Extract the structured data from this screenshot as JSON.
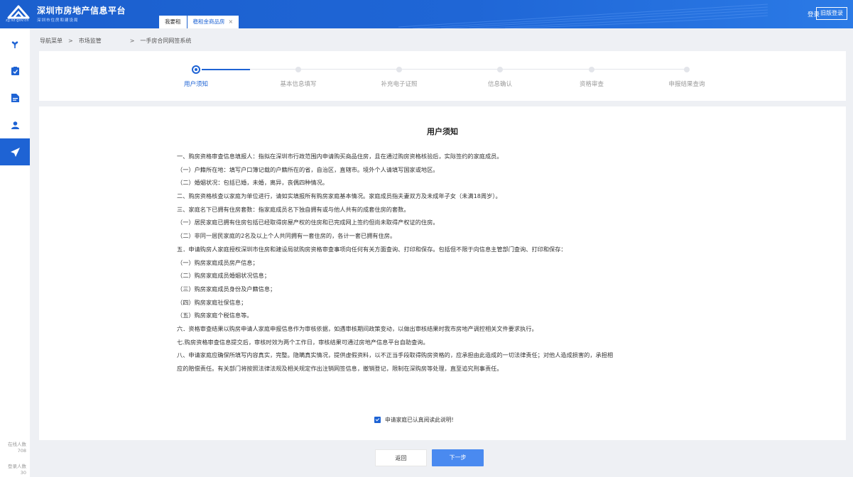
{
  "header": {
    "logo_domain": "zjj.sz.gov.cn",
    "title": "深圳市房地产信息平台",
    "subtitle": "深圳市住房和建设局",
    "tabs": [
      {
        "label": "我要租",
        "active": false
      },
      {
        "label": "稳租金商品房",
        "active": true,
        "closable": true
      }
    ],
    "close_glyph": "×",
    "login_label": "登录",
    "old_version_label": "旧版登录"
  },
  "sidebar": {
    "items": [
      {
        "icon": "flower-icon",
        "active": false
      },
      {
        "icon": "checklist-icon",
        "active": false
      },
      {
        "icon": "document-icon",
        "active": false
      },
      {
        "icon": "user-icon",
        "active": false
      },
      {
        "icon": "send-icon",
        "active": true
      }
    ],
    "online_label": "在线人数",
    "online_count": "708",
    "login_count_label": "登录人数",
    "login_count": "30"
  },
  "breadcrumb": {
    "items": [
      "导航菜单",
      "市场监管",
      "一手房合同网签系统"
    ],
    "separator": ">"
  },
  "steps": {
    "current": 0,
    "items": [
      "用户须知",
      "基本信息填写",
      "补充电子证照",
      "信息确认",
      "资格审查",
      "申报结果查询"
    ]
  },
  "notice": {
    "title": "用户须知",
    "lines": [
      "一、购房资格审查信息填报人：指拟在深圳市行政范围内申请购买商品住房，且在通过购房资格核验后，实际签约的家庭成员。",
      "（一）户籍所在地：填写户口簿记载的户籍所在的省，自治区，直辖市。境外个人请填写国家或地区。",
      "（二）婚姻状况：包括已婚，未婚，离异，丧偶四种情况。",
      "二、购房资格核查以家庭为单位进行，请如实填报所有购房家庭基本情况。家庭成员指夫妻双方及未成年子女（未满18周岁）。",
      "三、家庭名下已拥有住房套数：指家庭成员名下独自拥有或与他人共有的成套住房的套数。",
      "（一）居民家庭已拥有住房包括已经取得房屋产权的住房和已完成网上签约但尚未取得产权证的住房。",
      "（二）非同一居民家庭的2名及以上个人共同拥有一套住房的，各计一套已拥有住房。",
      "五．申请购房人家庭授权深圳市住房和建设局就购房资格审查事项向任何有关方面查询、打印和保存。包括但不限于向信息主管部门查询、打印和保存：",
      "（一）购房家庭成员房产信息；",
      "（二）购房家庭成员婚姻状况信息；",
      "（三）购房家庭成员身份及户籍信息；",
      "（四）购房家庭社保信息；",
      "（五）购房家庭个税信息等。",
      "六．资格审查结果以购房申请人家庭申报信息作为审核依据，如遇审核期间政策变动，以做出审核结果时我市房地产调控相关文件要求执行。",
      "七.购房资格审查信息提交后，审核时效为两个工作日，审核结果可通过房地产信息平台自助查询。",
      "八、申请家庭应确保所填写内容真实，完整。隐瞒真实情况，提供虚假资料，以不正当手段取得购房资格的，应承担由此造成的一切法律责任；对他人造成损害的，承担相",
      "应的赔偿责任。有关部门将按照法律法规及相关规定作出注销网签信息，撤销登记，限制在深购房等处理，直至追究刑事责任。"
    ],
    "agree_label": "申请家庭已认真阅读此说明!",
    "agree_checked": true
  },
  "actions": {
    "back_label": "返回",
    "next_label": "下一步"
  },
  "colors": {
    "primary": "#1e63d4",
    "next_button": "#4a8af0",
    "background": "#eef0f4"
  }
}
